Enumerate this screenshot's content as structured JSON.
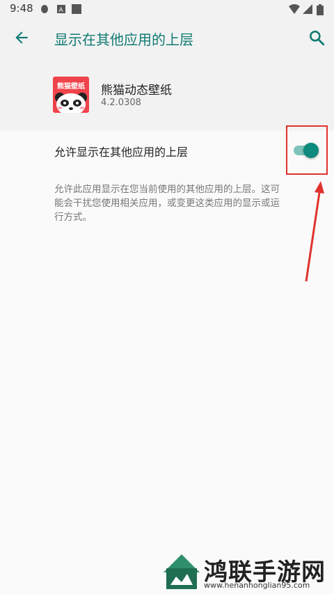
{
  "status_bar": {
    "time": "9:48"
  },
  "app_bar": {
    "title": "显示在其他应用的上层"
  },
  "app": {
    "name": "熊猫动态壁纸",
    "version": "4.2.0308",
    "icon_text": "熊猫壁纸"
  },
  "setting": {
    "title": "允许显示在其他应用的上层",
    "enabled": true,
    "description": "允许此应用显示在您当前使用的其他应用的上层。这可能会干扰您使用相关应用，或变更这类应用的显示或运行方式。"
  },
  "watermark": {
    "name": "鸿联手游网",
    "url": "www.henanhonglian95.com"
  },
  "colors": {
    "accent": "#107a72",
    "toggle_on": "#0e8a7e",
    "annotation": "#e0322e"
  }
}
